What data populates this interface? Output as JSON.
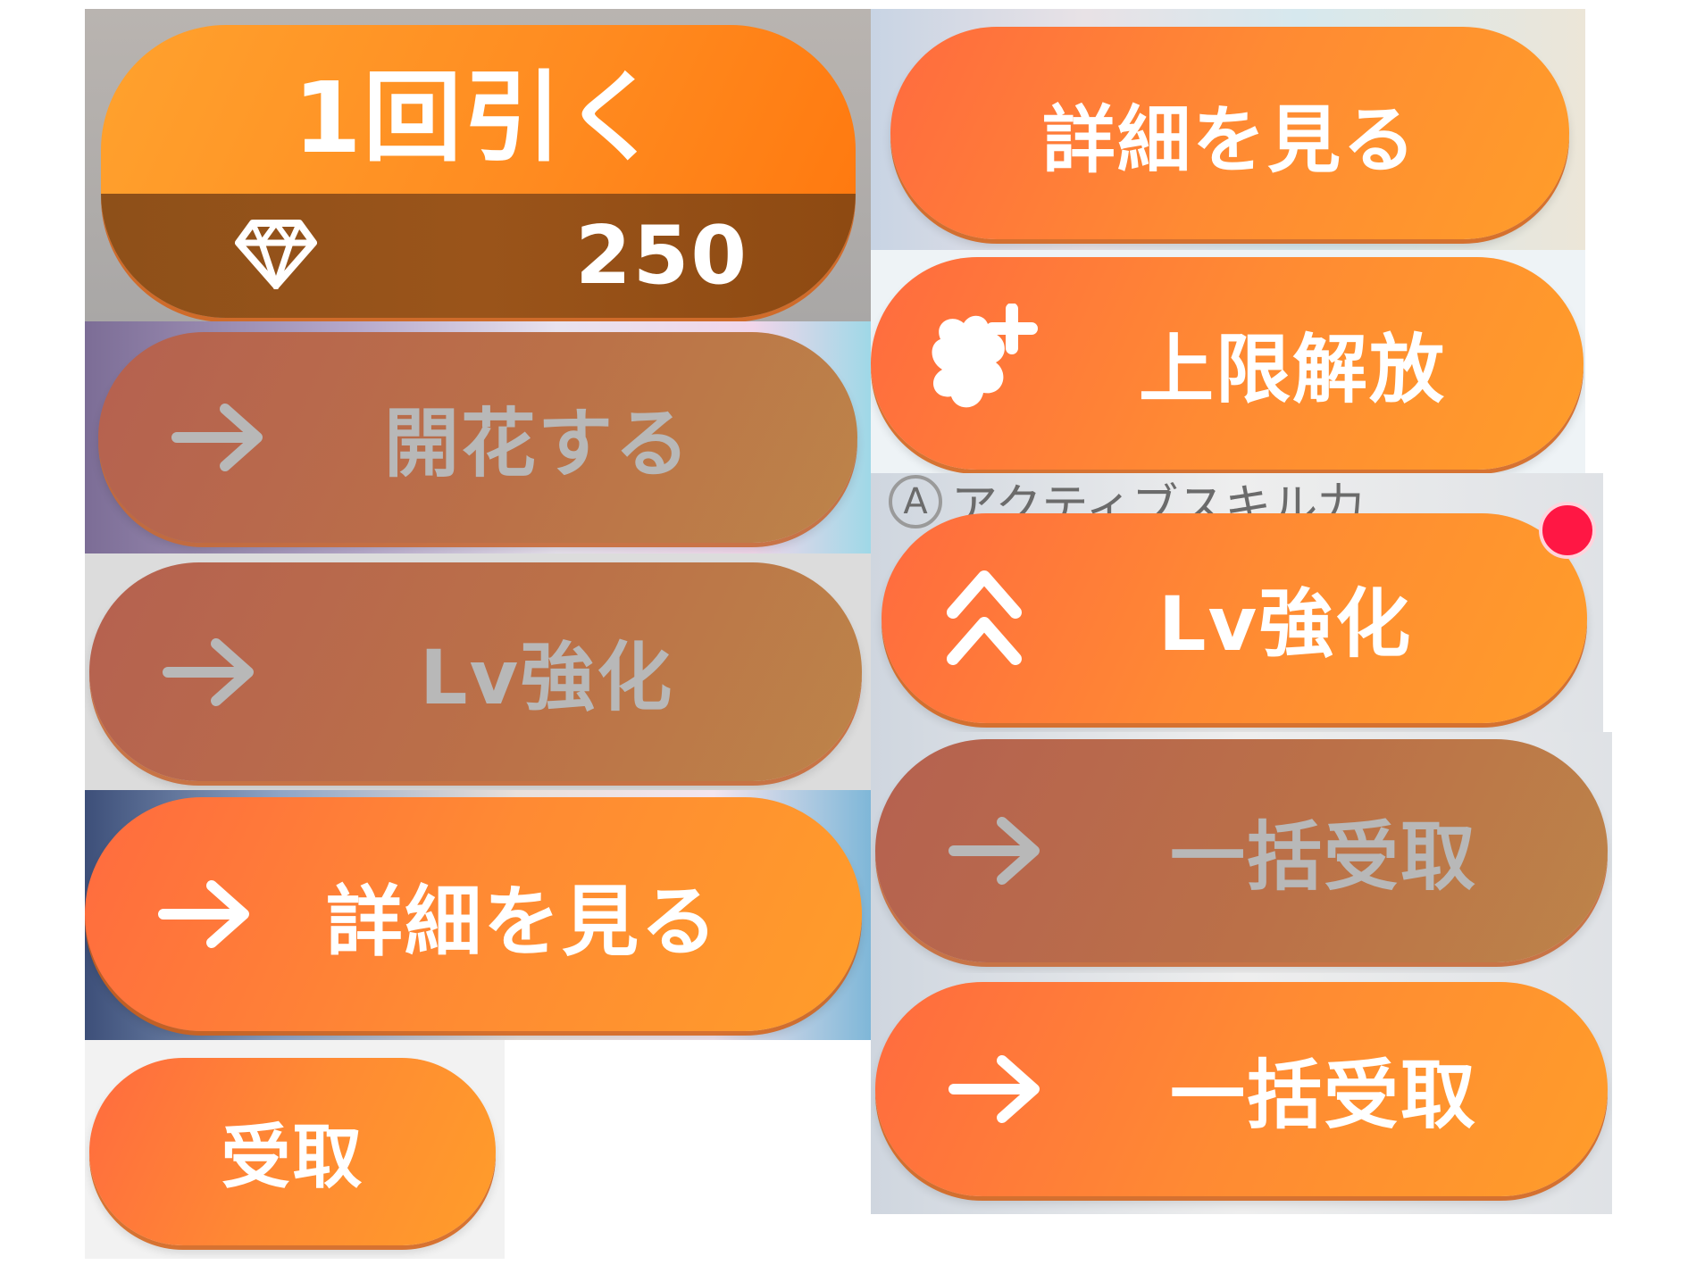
{
  "gacha_button": {
    "label": "1回引く",
    "cost_icon": "diamond-icon",
    "cost": "250"
  },
  "buttons": {
    "details_top": {
      "label": "詳細を見る"
    },
    "bloom": {
      "label": "開花する",
      "icon": "arrow-right-icon",
      "state": "disabled"
    },
    "limit_break": {
      "label": "上限解放",
      "icon": "puzzle-plus-icon"
    },
    "lv_up_disabled": {
      "label": "Lv強化",
      "icon": "arrow-right-icon",
      "state": "disabled"
    },
    "lv_up_active": {
      "label": "Lv強化",
      "icon": "double-chevron-up-icon",
      "badge": "notification-dot"
    },
    "details_arrow": {
      "label": "詳細を見る",
      "icon": "arrow-right-icon"
    },
    "bulk_receive_disabled": {
      "label": "一括受取",
      "icon": "arrow-right-icon",
      "state": "disabled"
    },
    "receive": {
      "label": "受取"
    },
    "bulk_receive_active": {
      "label": "一括受取",
      "icon": "arrow-right-icon"
    }
  },
  "background_text": {
    "skill_row": "アクティブスキル力"
  },
  "colors": {
    "active_start": "#ff6b3f",
    "active_end": "#ff9d2a",
    "disabled": "#bb7048",
    "badge": "#ff1744"
  }
}
